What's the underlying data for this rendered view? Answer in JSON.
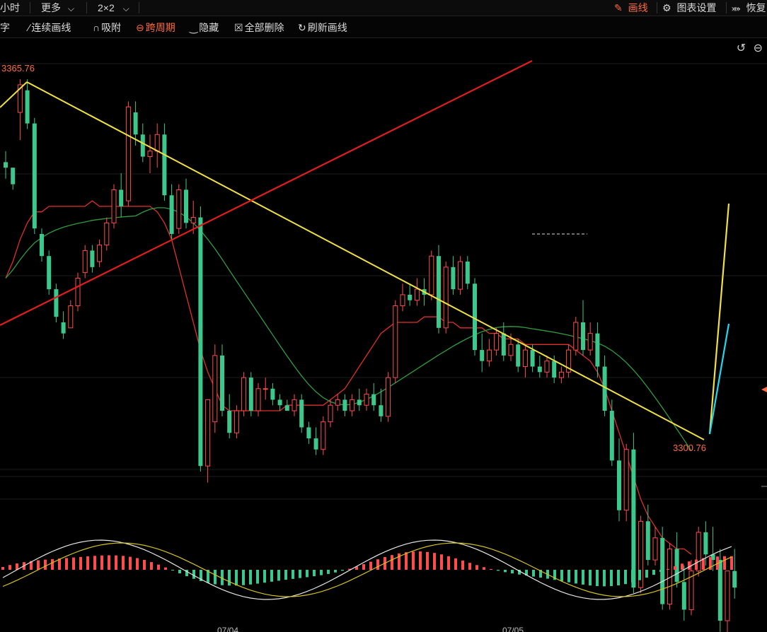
{
  "toolbar_top": {
    "period": "小时",
    "more": "更多",
    "layout": "2×2",
    "draw_label": "画线",
    "chart_settings": "图表设置",
    "restore": "恢复"
  },
  "toolbar_draw": {
    "text_tool": "字",
    "continuous_draw": "连续画线",
    "snap": "吸附",
    "cross_period": "跨周期",
    "hide": "隐藏",
    "delete_all": "全部删除",
    "refresh_lines": "刷新画线"
  },
  "colors": {
    "up": "#ff4d4d",
    "down": "#3cc88c",
    "ma_short": "#e0302a",
    "ma_long": "#2f9e3e",
    "trend_yellow": "#f0e040",
    "trend_red": "#e01e1e",
    "trend_cyan": "#20d8f0",
    "accent": "#ff6a3c"
  },
  "chart_data": {
    "type": "candlestick",
    "x_ticks": [
      "07/04",
      "07/05"
    ],
    "high_label": "3365.76",
    "low_label": "3300.76",
    "candles": [
      [
        3351,
        3353,
        3348,
        3350
      ],
      [
        3350,
        3350,
        3346,
        3347
      ],
      [
        3360,
        3366,
        3355,
        3365
      ],
      [
        3364,
        3366,
        3357,
        3358
      ],
      [
        3358,
        3359,
        3338,
        3339
      ],
      [
        3338,
        3339,
        3333,
        3334
      ],
      [
        3334,
        3335,
        3327,
        3328
      ],
      [
        3328,
        3329,
        3322,
        3323
      ],
      [
        3322,
        3324,
        3319,
        3320
      ],
      [
        3321,
        3326,
        3321,
        3325
      ],
      [
        3325,
        3331,
        3324,
        3330
      ],
      [
        3331,
        3336,
        3330,
        3335
      ],
      [
        3335,
        3336,
        3331,
        3332
      ],
      [
        3333,
        3337,
        3332,
        3336
      ],
      [
        3336,
        3341,
        3335,
        3340
      ],
      [
        3340,
        3347,
        3339,
        3346
      ],
      [
        3346,
        3349,
        3341,
        3343
      ],
      [
        3344,
        3362,
        3343,
        3361
      ],
      [
        3360,
        3362,
        3354,
        3356
      ],
      [
        3356,
        3358,
        3351,
        3352
      ],
      [
        3352,
        3356,
        3349,
        3353
      ],
      [
        3353,
        3358,
        3350,
        3356
      ],
      [
        3356,
        3358,
        3344,
        3345
      ],
      [
        3345,
        3347,
        3337,
        3338
      ],
      [
        3339,
        3347,
        3338,
        3346
      ],
      [
        3346,
        3348,
        3339,
        3340
      ],
      [
        3340,
        3344,
        3338,
        3341
      ],
      [
        3341,
        3343,
        3295,
        3296
      ],
      [
        3296,
        3300,
        3293,
        3308
      ],
      [
        3304,
        3318,
        3302,
        3316
      ],
      [
        3316,
        3318,
        3305,
        3306
      ],
      [
        3306,
        3309,
        3301,
        3302
      ],
      [
        3302,
        3307,
        3301,
        3306
      ],
      [
        3306,
        3313,
        3305,
        3312
      ],
      [
        3312,
        3313,
        3305,
        3306
      ],
      [
        3306,
        3311,
        3305,
        3310
      ],
      [
        3310,
        3312,
        3308,
        3310
      ],
      [
        3310,
        3311,
        3307,
        3308
      ],
      [
        3308,
        3309,
        3306,
        3307
      ],
      [
        3307,
        3308,
        3306,
        3306
      ],
      [
        3306,
        3309,
        3305,
        3308
      ],
      [
        3308,
        3309,
        3302,
        3303
      ],
      [
        3303,
        3304,
        3300,
        3301
      ],
      [
        3301,
        3303,
        3298,
        3299
      ],
      [
        3299,
        3305,
        3298,
        3304
      ],
      [
        3304,
        3308,
        3303,
        3307
      ],
      [
        3307,
        3309,
        3306,
        3308
      ],
      [
        3308,
        3309,
        3305,
        3306
      ],
      [
        3306,
        3309,
        3305,
        3308
      ],
      [
        3308,
        3310,
        3306,
        3307
      ],
      [
        3307,
        3310,
        3306,
        3309
      ],
      [
        3309,
        3311,
        3306,
        3307
      ],
      [
        3307,
        3310,
        3304,
        3305
      ],
      [
        3305,
        3313,
        3304,
        3312
      ],
      [
        3312,
        3326,
        3311,
        3325
      ],
      [
        3325,
        3329,
        3324,
        3327
      ],
      [
        3327,
        3329,
        3325,
        3326
      ],
      [
        3326,
        3330,
        3325,
        3328
      ],
      [
        3328,
        3330,
        3325,
        3327
      ],
      [
        3327,
        3335,
        3326,
        3334
      ],
      [
        3334,
        3336,
        3320,
        3321
      ],
      [
        3321,
        3333,
        3320,
        3332
      ],
      [
        3332,
        3334,
        3327,
        3328
      ],
      [
        3328,
        3334,
        3327,
        3333
      ],
      [
        3333,
        3334,
        3328,
        3329
      ],
      [
        3329,
        3330,
        3316,
        3317
      ],
      [
        3317,
        3320,
        3313,
        3315
      ],
      [
        3315,
        3319,
        3314,
        3317
      ],
      [
        3317,
        3321,
        3316,
        3320
      ],
      [
        3320,
        3322,
        3315,
        3316
      ],
      [
        3316,
        3320,
        3315,
        3318
      ],
      [
        3318,
        3319,
        3313,
        3314
      ],
      [
        3314,
        3318,
        3312,
        3317
      ],
      [
        3317,
        3318,
        3313,
        3314
      ],
      [
        3314,
        3316,
        3312,
        3313
      ],
      [
        3313,
        3316,
        3312,
        3315
      ],
      [
        3315,
        3316,
        3311,
        3312
      ],
      [
        3312,
        3314,
        3311,
        3313
      ],
      [
        3313,
        3318,
        3312,
        3317
      ],
      [
        3317,
        3323,
        3316,
        3322
      ],
      [
        3322,
        3326,
        3316,
        3317
      ],
      [
        3317,
        3322,
        3316,
        3320
      ],
      [
        3320,
        3322,
        3312,
        3314
      ],
      [
        3314,
        3316,
        3305,
        3306
      ],
      [
        3306,
        3308,
        3296,
        3297
      ],
      [
        3297,
        3301,
        3286,
        3288
      ],
      [
        3288,
        3300,
        3286,
        3299
      ],
      [
        3299,
        3302,
        3273,
        3274
      ],
      [
        3274,
        3287,
        3273,
        3286
      ],
      [
        3286,
        3289,
        3278,
        3279
      ],
      [
        3279,
        3285,
        3278,
        3283
      ],
      [
        3283,
        3285,
        3270,
        3271
      ],
      [
        3271,
        3282,
        3270,
        3281
      ],
      [
        3281,
        3284,
        3274,
        3275
      ],
      [
        3275,
        3278,
        3268,
        3270
      ],
      [
        3270,
        3279,
        3269,
        3277
      ],
      [
        3277,
        3285,
        3276,
        3284
      ],
      [
        3284,
        3286,
        3278,
        3280
      ],
      [
        3280,
        3285,
        3277,
        3279
      ],
      [
        3279,
        3281,
        3266,
        3268
      ],
      [
        3268,
        3276,
        3262,
        3277
      ],
      [
        3277,
        3281,
        3272,
        3274
      ]
    ],
    "ma_short": [
      3330,
      3333,
      3337,
      3340,
      3342,
      3342,
      3343,
      3343,
      3343,
      3343,
      3343,
      3343,
      3344,
      3343,
      3343,
      3343,
      3343,
      3343,
      3343,
      3343,
      3343,
      3342,
      3340,
      3337,
      3332,
      3327,
      3322,
      3317,
      3313,
      3310,
      3307,
      3306,
      3306,
      3306,
      3306,
      3306,
      3306,
      3306,
      3306,
      3307,
      3307,
      3307,
      3307,
      3307,
      3307,
      3308,
      3309,
      3310,
      3312,
      3314,
      3316,
      3318,
      3320,
      3321,
      3322,
      3322,
      3322,
      3322,
      3323,
      3323,
      3323,
      3322,
      3322,
      3321,
      3321,
      3321,
      3321,
      3320,
      3320,
      3319,
      3319,
      3319,
      3318,
      3318,
      3318,
      3318,
      3318,
      3318,
      3318,
      3317,
      3316,
      3315,
      3313,
      3310,
      3306,
      3302,
      3298,
      3294,
      3290,
      3287,
      3285,
      3283,
      3282,
      3281,
      3281,
      3280
    ]
  }
}
